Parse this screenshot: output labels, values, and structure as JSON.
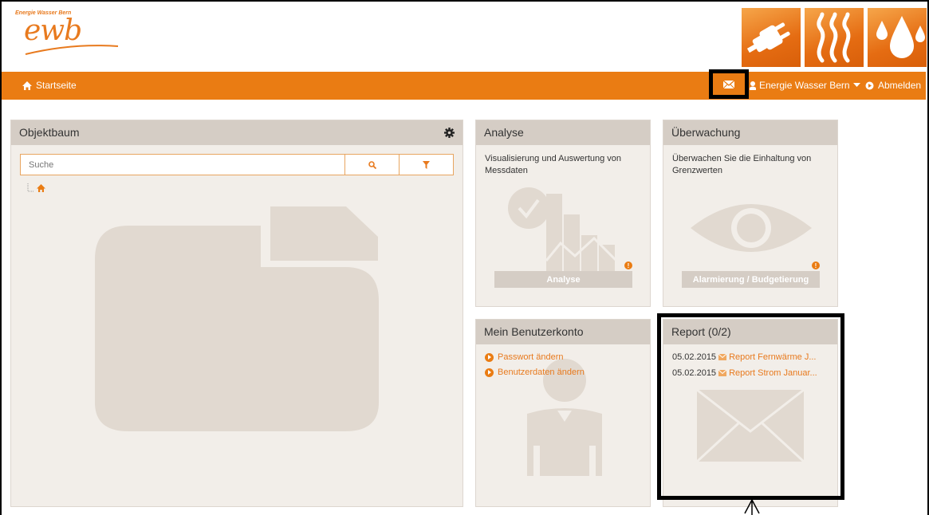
{
  "header": {
    "logo_subtitle": "Energie Wasser Bern",
    "logo_text": "ewb",
    "tiles": [
      "plug-icon",
      "heat-icon",
      "water-drops-icon"
    ]
  },
  "nav": {
    "home_label": "Startseite",
    "user_label": "Energie Wasser Bern",
    "logout_label": "Abmelden"
  },
  "objektbaum": {
    "title": "Objektbaum",
    "search_placeholder": "Suche"
  },
  "analyse": {
    "title": "Analyse",
    "description": "Visualisierung und Auswertung von Messdaten",
    "button_label": "Analyse",
    "warning": "!"
  },
  "ueberwachung": {
    "title": "Überwachung",
    "description": "Überwachen Sie die Einhaltung von Grenzwerten",
    "button_label": "Alarmierung / Budgetierung",
    "warning": "!"
  },
  "konto": {
    "title": "Mein Benutzerkonto",
    "links": [
      "Passwort ändern",
      "Benutzerdaten ändern"
    ]
  },
  "report": {
    "title": "Report (0/2)",
    "items": [
      {
        "date": "05.02.2015",
        "label": "Report Fernwärme J..."
      },
      {
        "date": "05.02.2015",
        "label": "Report Strom Januar..."
      }
    ]
  },
  "colors": {
    "accent": "#ea7c13",
    "panel_header": "#d5cdc5",
    "panel_body": "#f2eee9"
  }
}
